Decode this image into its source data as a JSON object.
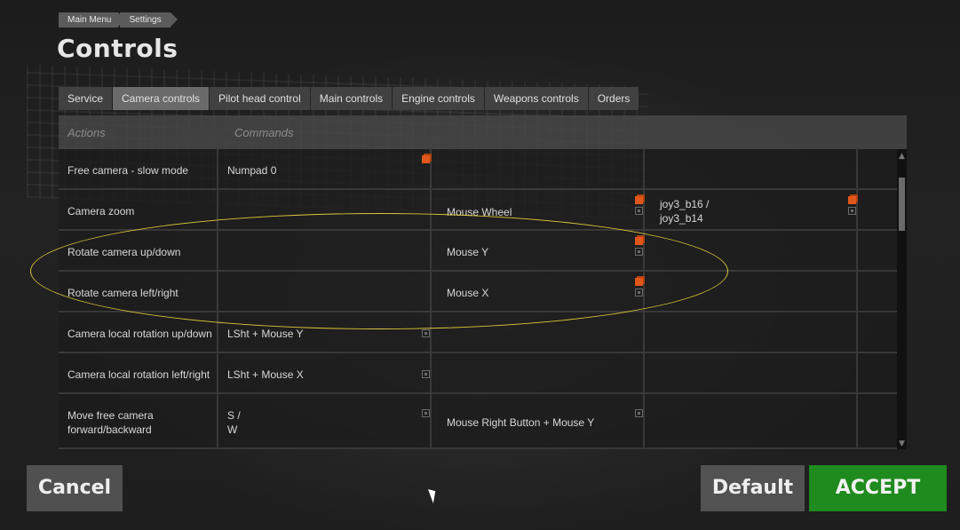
{
  "breadcrumb": [
    "Main Menu",
    "Settings"
  ],
  "page_title": "Controls",
  "tabs": [
    {
      "label": "Service",
      "active": false
    },
    {
      "label": "Camera controls",
      "active": true
    },
    {
      "label": "Pilot head control",
      "active": false
    },
    {
      "label": "Main controls",
      "active": false
    },
    {
      "label": "Engine controls",
      "active": false
    },
    {
      "label": "Weapons controls",
      "active": false
    },
    {
      "label": "Orders",
      "active": false
    }
  ],
  "table": {
    "header_actions": "Actions",
    "header_commands": "Commands",
    "rows": [
      {
        "action": "Free camera - slow mode",
        "cmd1": "Numpad 0",
        "cmd2": "",
        "cmd3": "",
        "icons": {
          "cmd1": [
            "orange-conflict-icon"
          ],
          "cmd2": [],
          "cmd3": []
        }
      },
      {
        "action": "Camera zoom",
        "cmd1": "",
        "cmd2": "Mouse Wheel",
        "cmd3": "joy3_b16 /\njoy3_b14",
        "icons": {
          "cmd1": [],
          "cmd2": [
            "orange-conflict-icon",
            "gray-modifier-icon"
          ],
          "cmd3": [
            "orange-conflict-icon",
            "gray-modifier-icon"
          ]
        }
      },
      {
        "action": "Rotate camera up/down",
        "cmd1": "",
        "cmd2": "Mouse Y",
        "cmd3": "",
        "icons": {
          "cmd1": [],
          "cmd2": [
            "orange-conflict-icon",
            "gray-modifier-icon"
          ],
          "cmd3": []
        }
      },
      {
        "action": "Rotate camera left/right",
        "cmd1": "",
        "cmd2": "Mouse X",
        "cmd3": "",
        "icons": {
          "cmd1": [],
          "cmd2": [
            "orange-conflict-icon",
            "gray-modifier-icon"
          ],
          "cmd3": []
        }
      },
      {
        "action": "Camera local rotation up/down",
        "cmd1": "LSht + Mouse Y",
        "cmd2": "",
        "cmd3": "",
        "icons": {
          "cmd1": [
            "gray-modifier-icon"
          ],
          "cmd2": [],
          "cmd3": []
        }
      },
      {
        "action": "Camera local rotation left/right",
        "cmd1": "LSht + Mouse X",
        "cmd2": "",
        "cmd3": "",
        "icons": {
          "cmd1": [
            "gray-modifier-icon"
          ],
          "cmd2": [],
          "cmd3": []
        }
      },
      {
        "action": "Move free camera\nforward/backward",
        "cmd1": "S /\nW",
        "cmd2": "Mouse Right Button + Mouse Y",
        "cmd3": "",
        "icons": {
          "cmd1": [
            "gray-modifier-icon"
          ],
          "cmd2": [
            "gray-modifier-icon"
          ],
          "cmd3": []
        }
      }
    ]
  },
  "buttons": {
    "cancel": "Cancel",
    "default": "Default",
    "accept": "ACCEPT"
  },
  "colors": {
    "accept_green": "#1f8a1d",
    "conflict_orange": "#e0561b",
    "highlight_yellow": "#d8c83a"
  }
}
